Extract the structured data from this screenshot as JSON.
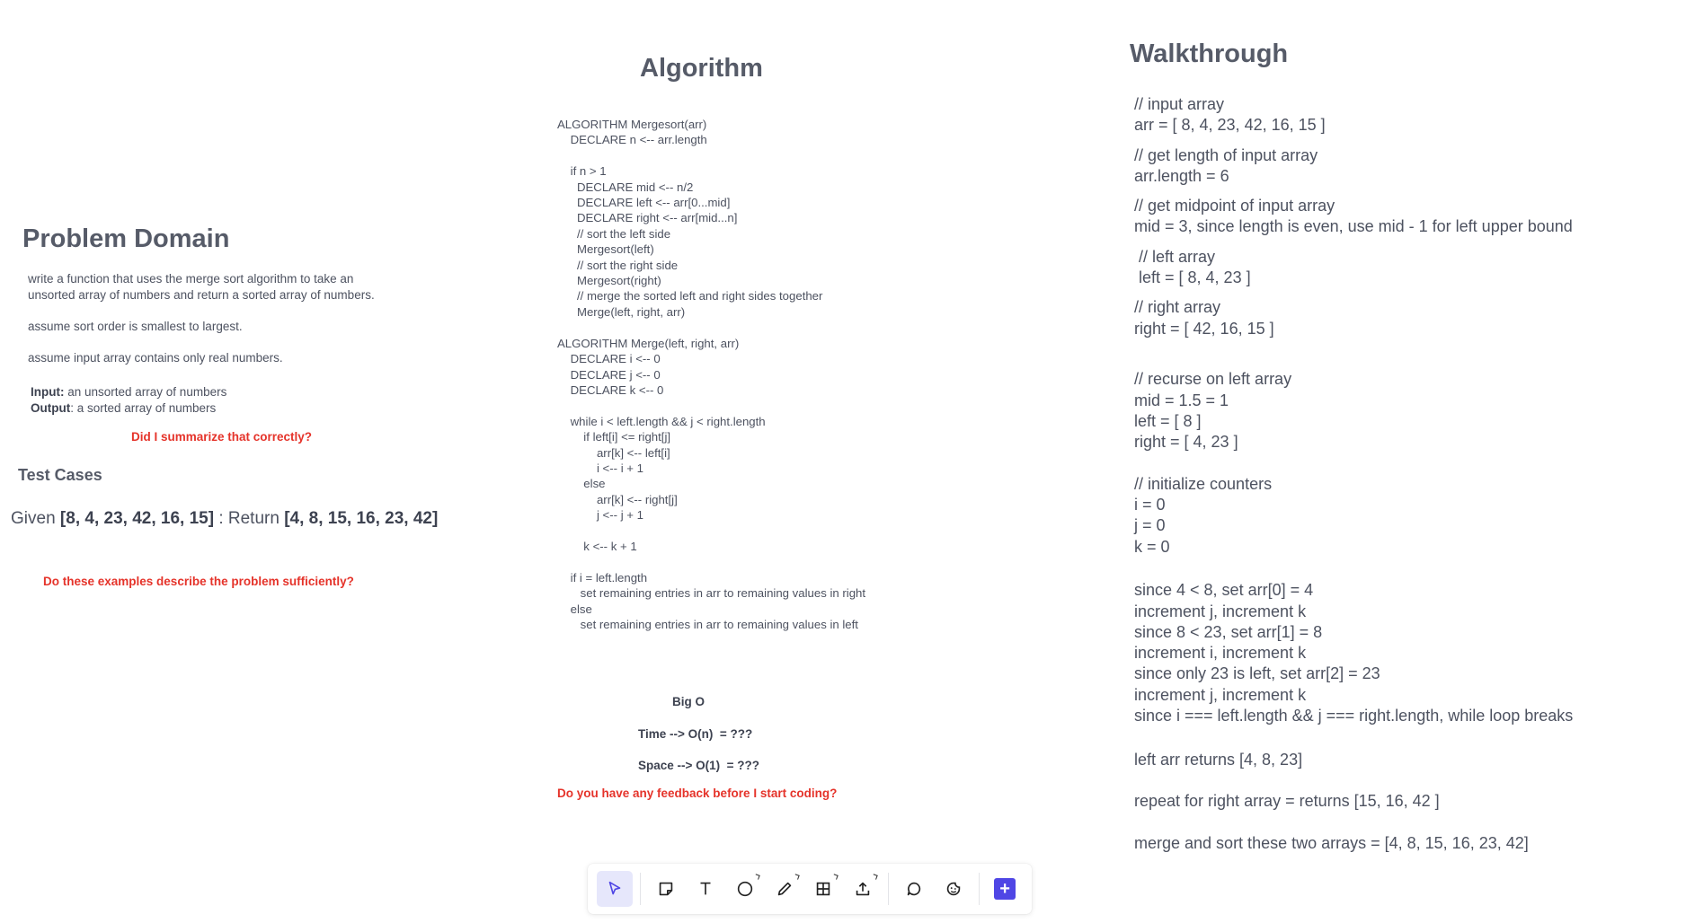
{
  "problem": {
    "title": "Problem Domain",
    "desc1": "write a function that uses the merge sort algorithm to take an",
    "desc2": "unsorted array of numbers and return a sorted array of numbers.",
    "desc3": "assume sort order is smallest to largest.",
    "desc4": "assume input array contains only real numbers.",
    "input_label": "Input:",
    "input_text": " an unsorted array of numbers",
    "output_label": "Output",
    "output_text": ": a sorted array of numbers",
    "question": "Did I summarize that correctly?"
  },
  "tests": {
    "title": "Test Cases",
    "given_label": "Given ",
    "given_arr": "[8, 4, 23, 42, 16, 15]",
    "return_label": " : Return ",
    "return_arr": "[4, 8, 15, 16, 23, 42]",
    "question": "Do these examples describe the problem sufficiently?"
  },
  "algorithm": {
    "title": "Algorithm",
    "code": "ALGORITHM Mergesort(arr)\n    DECLARE n <-- arr.length\n\n    if n > 1\n      DECLARE mid <-- n/2\n      DECLARE left <-- arr[0...mid]\n      DECLARE right <-- arr[mid...n]\n      // sort the left side\n      Mergesort(left)\n      // sort the right side\n      Mergesort(right)\n      // merge the sorted left and right sides together\n      Merge(left, right, arr)\n\nALGORITHM Merge(left, right, arr)\n    DECLARE i <-- 0\n    DECLARE j <-- 0\n    DECLARE k <-- 0\n\n    while i < left.length && j < right.length\n        if left[i] <= right[j]\n            arr[k] <-- left[i]\n            i <-- i + 1\n        else\n            arr[k] <-- right[j]\n            j <-- j + 1\n\n        k <-- k + 1\n\n    if i = left.length\n       set remaining entries in arr to remaining values in right\n    else\n       set remaining entries in arr to remaining values in left",
    "bigo_title": "Big O",
    "time": "Time --> O(n)  = ???",
    "space": "Space --> O(1)  = ???",
    "question": "Do you have any feedback before I start coding?"
  },
  "walkthrough": {
    "title": "Walkthrough",
    "blocks": [
      "// input array\narr = [ 8, 4, 23, 42, 16, 15 ]",
      "// get length of input array\narr.length = 6",
      "// get midpoint of input array\nmid = 3, since length is even, use mid - 1 for left upper bound",
      " // left array\n left = [ 8, 4, 23 ]",
      "// right array\nright = [ 42, 16, 15 ]",
      "\n// recurse on left array\nmid = 1.5 = 1\nleft = [ 8 ]\nright = [ 4, 23 ]",
      "\n// initialize counters\ni = 0\nj = 0\nk = 0",
      "\nsince 4 < 8, set arr[0] = 4\nincrement j, increment k\nsince 8 < 23, set arr[1] = 8\nincrement i, increment k\nsince only 23 is left, set arr[2] = 23\nincrement j, increment k\nsince i === left.length && j === right.length, while loop breaks",
      "\nleft arr returns [4, 8, 23]",
      "\nrepeat for right array = returns [15, 16, 42 ]",
      "\nmerge and sort these two arrays = [4, 8, 15, 16, 23, 42]"
    ]
  },
  "toolbar": {
    "tools": [
      "pointer-tool",
      "sticky-note-tool",
      "text-tool",
      "shape-tool",
      "pen-tool",
      "table-tool",
      "upload-tool",
      "comment-tool",
      "reaction-tool",
      "add-tool"
    ],
    "accent": "#4f46e5"
  }
}
